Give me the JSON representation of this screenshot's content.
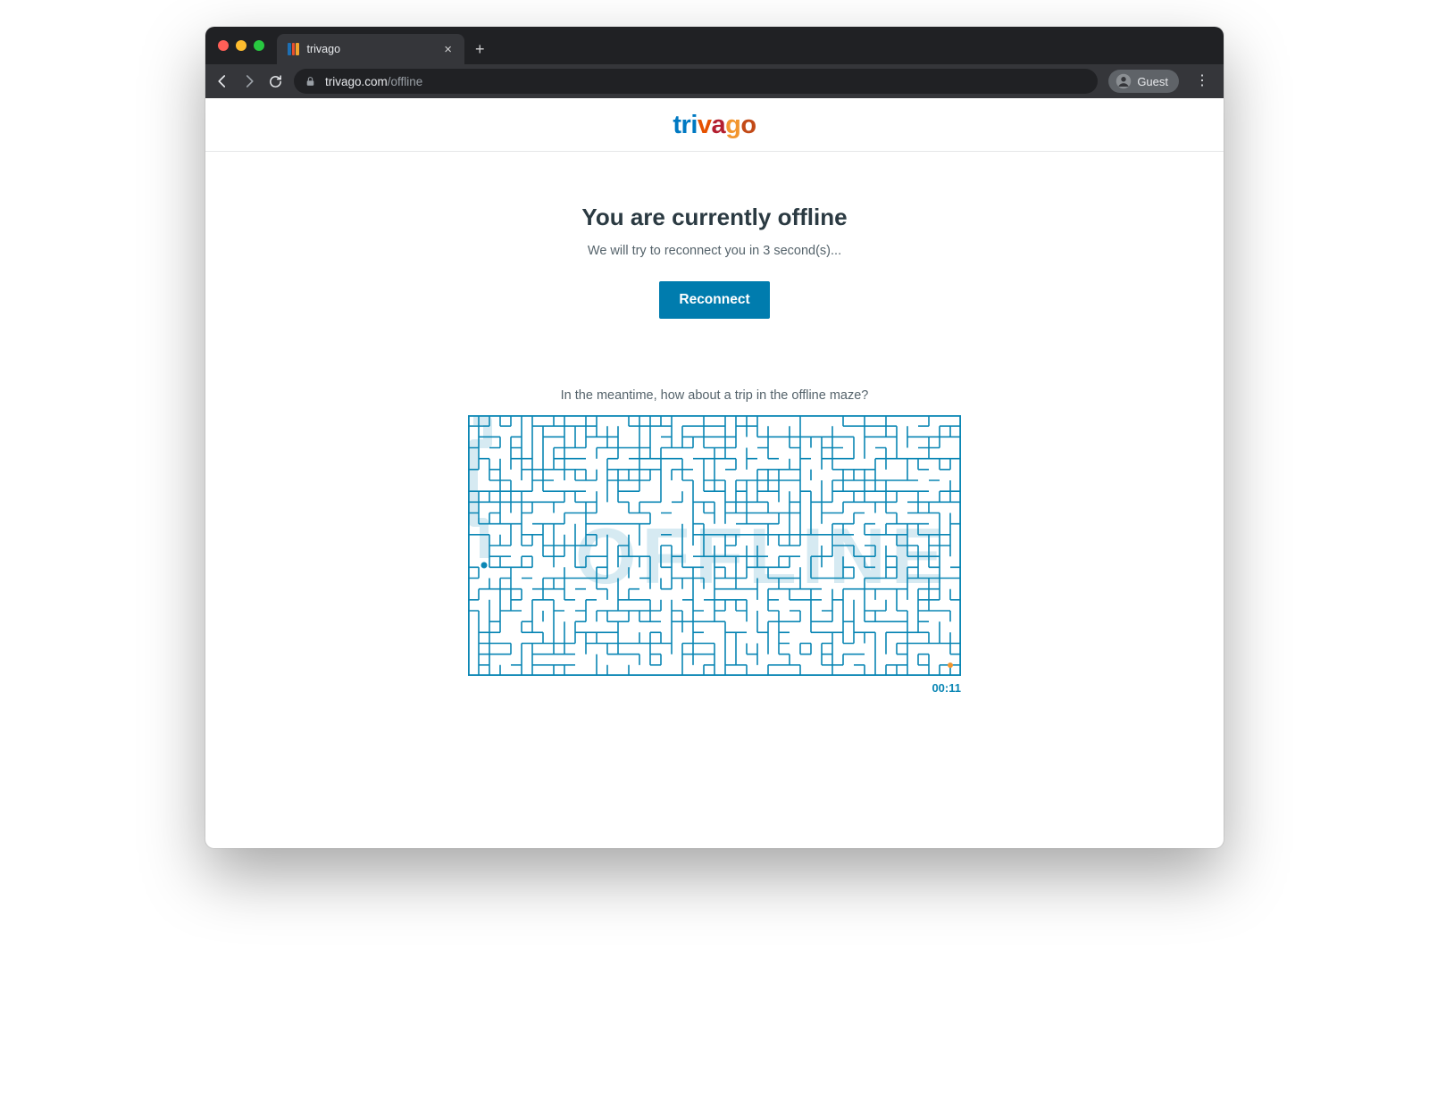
{
  "browser": {
    "tab_title": "trivago",
    "url_domain": "trivago.com",
    "url_path": "/offline",
    "guest_label": "Guest"
  },
  "logo": {
    "t": "tri",
    "v": "v",
    "a": "a",
    "g": "g",
    "o": "o"
  },
  "offline": {
    "heading": "You are currently offline",
    "subtext": "We will try to reconnect you in 3 second(s)...",
    "button": "Reconnect",
    "meantime": "In the meantime, how about a trip in the offline maze?",
    "maze_word": "OFFLINE",
    "timer": "00:11"
  }
}
